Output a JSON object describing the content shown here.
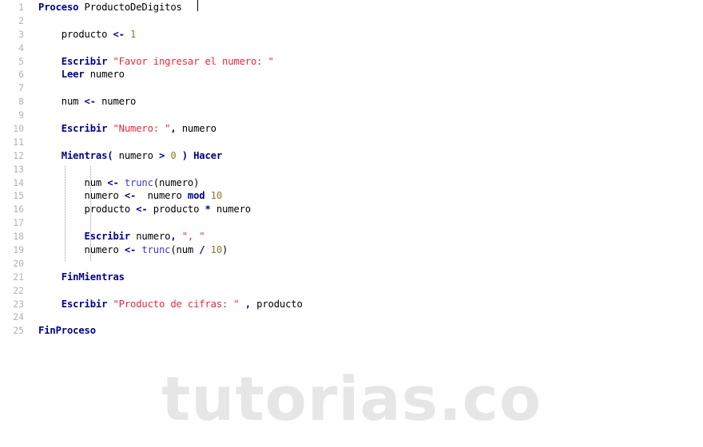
{
  "editor": {
    "language": "PSeInt",
    "colors": {
      "background": "#ffffff",
      "line_number": "#b2b2b2",
      "keyword": "#00008b",
      "string": "#e8283c",
      "number": "#8a7a2a",
      "identifier": "#000000",
      "function": "#3a3ad0",
      "indent_guide": "#9a9a9a",
      "watermark": "#e6e6e6"
    },
    "caret_line": 1,
    "line_numbers": [
      "1",
      "2",
      "3",
      "4",
      "5",
      "6",
      "7",
      "8",
      "9",
      "10",
      "11",
      "12",
      "13",
      "14",
      "15",
      "16",
      "17",
      "18",
      "19",
      "20",
      "21",
      "22",
      "23",
      "24",
      "25"
    ],
    "lines": [
      {
        "n": "1",
        "indent": 0,
        "tokens": [
          {
            "t": "Proceso",
            "c": "kw"
          },
          {
            "t": " ",
            "c": "id"
          },
          {
            "t": "ProductoDeDigitos",
            "c": "id"
          }
        ]
      },
      {
        "n": "2",
        "indent": 0,
        "tokens": []
      },
      {
        "n": "3",
        "indent": 4,
        "tokens": [
          {
            "t": "producto ",
            "c": "id"
          },
          {
            "t": "<-",
            "c": "op"
          },
          {
            "t": " ",
            "c": "id"
          },
          {
            "t": "1",
            "c": "num"
          }
        ]
      },
      {
        "n": "4",
        "indent": 0,
        "tokens": []
      },
      {
        "n": "5",
        "indent": 4,
        "tokens": [
          {
            "t": "Escribir",
            "c": "kw"
          },
          {
            "t": " ",
            "c": "id"
          },
          {
            "t": "\"Favor ingresar el numero: \"",
            "c": "str"
          }
        ]
      },
      {
        "n": "6",
        "indent": 4,
        "tokens": [
          {
            "t": "Leer",
            "c": "kw"
          },
          {
            "t": " numero",
            "c": "id"
          }
        ]
      },
      {
        "n": "7",
        "indent": 0,
        "tokens": []
      },
      {
        "n": "8",
        "indent": 4,
        "tokens": [
          {
            "t": "num ",
            "c": "id"
          },
          {
            "t": "<-",
            "c": "op"
          },
          {
            "t": " numero",
            "c": "id"
          }
        ]
      },
      {
        "n": "9",
        "indent": 0,
        "tokens": []
      },
      {
        "n": "10",
        "indent": 4,
        "tokens": [
          {
            "t": "Escribir",
            "c": "kw"
          },
          {
            "t": " ",
            "c": "id"
          },
          {
            "t": "\"Numero: \"",
            "c": "str"
          },
          {
            "t": ",",
            "c": "op"
          },
          {
            "t": " numero",
            "c": "id"
          }
        ]
      },
      {
        "n": "11",
        "indent": 0,
        "tokens": []
      },
      {
        "n": "12",
        "indent": 4,
        "tokens": [
          {
            "t": "Mientras",
            "c": "kw"
          },
          {
            "t": "(",
            "c": "op"
          },
          {
            "t": " numero ",
            "c": "id"
          },
          {
            "t": ">",
            "c": "op"
          },
          {
            "t": " ",
            "c": "id"
          },
          {
            "t": "0",
            "c": "num"
          },
          {
            "t": " ",
            "c": "id"
          },
          {
            "t": ")",
            "c": "op"
          },
          {
            "t": " ",
            "c": "id"
          },
          {
            "t": "Hacer",
            "c": "kw"
          }
        ]
      },
      {
        "n": "13",
        "indent": 0,
        "tokens": []
      },
      {
        "n": "14",
        "indent": 8,
        "tokens": [
          {
            "t": "num ",
            "c": "id"
          },
          {
            "t": "<-",
            "c": "op"
          },
          {
            "t": " ",
            "c": "id"
          },
          {
            "t": "trunc",
            "c": "fn"
          },
          {
            "t": "(numero)",
            "c": "id"
          }
        ]
      },
      {
        "n": "15",
        "indent": 8,
        "tokens": [
          {
            "t": "numero ",
            "c": "id"
          },
          {
            "t": "<-",
            "c": "op"
          },
          {
            "t": "  numero ",
            "c": "id"
          },
          {
            "t": "mod",
            "c": "op"
          },
          {
            "t": " ",
            "c": "id"
          },
          {
            "t": "10",
            "c": "num"
          }
        ]
      },
      {
        "n": "16",
        "indent": 8,
        "tokens": [
          {
            "t": "producto ",
            "c": "id"
          },
          {
            "t": "<-",
            "c": "op"
          },
          {
            "t": " producto ",
            "c": "id"
          },
          {
            "t": "*",
            "c": "op"
          },
          {
            "t": " numero",
            "c": "id"
          }
        ]
      },
      {
        "n": "17",
        "indent": 0,
        "tokens": []
      },
      {
        "n": "18",
        "indent": 8,
        "tokens": [
          {
            "t": "Escribir",
            "c": "kw"
          },
          {
            "t": " numero",
            "c": "id"
          },
          {
            "t": ",",
            "c": "op"
          },
          {
            "t": " ",
            "c": "id"
          },
          {
            "t": "\", \"",
            "c": "str"
          }
        ]
      },
      {
        "n": "19",
        "indent": 8,
        "tokens": [
          {
            "t": "numero ",
            "c": "id"
          },
          {
            "t": "<-",
            "c": "op"
          },
          {
            "t": " ",
            "c": "id"
          },
          {
            "t": "trunc",
            "c": "fn"
          },
          {
            "t": "(num ",
            "c": "id"
          },
          {
            "t": "/",
            "c": "op"
          },
          {
            "t": " ",
            "c": "id"
          },
          {
            "t": "10",
            "c": "num"
          },
          {
            "t": ")",
            "c": "id"
          }
        ]
      },
      {
        "n": "20",
        "indent": 0,
        "tokens": []
      },
      {
        "n": "21",
        "indent": 4,
        "tokens": [
          {
            "t": "FinMientras",
            "c": "kw"
          }
        ]
      },
      {
        "n": "22",
        "indent": 0,
        "tokens": []
      },
      {
        "n": "23",
        "indent": 4,
        "tokens": [
          {
            "t": "Escribir",
            "c": "kw"
          },
          {
            "t": " ",
            "c": "id"
          },
          {
            "t": "\"Producto de cifras: \"",
            "c": "str"
          },
          {
            "t": " ",
            "c": "id"
          },
          {
            "t": ",",
            "c": "op"
          },
          {
            "t": " producto",
            "c": "id"
          }
        ]
      },
      {
        "n": "24",
        "indent": 0,
        "tokens": []
      },
      {
        "n": "25",
        "indent": 0,
        "tokens": [
          {
            "t": "FinProceso",
            "c": "kw"
          }
        ]
      }
    ]
  },
  "watermark": {
    "text": "tutorias.co"
  }
}
